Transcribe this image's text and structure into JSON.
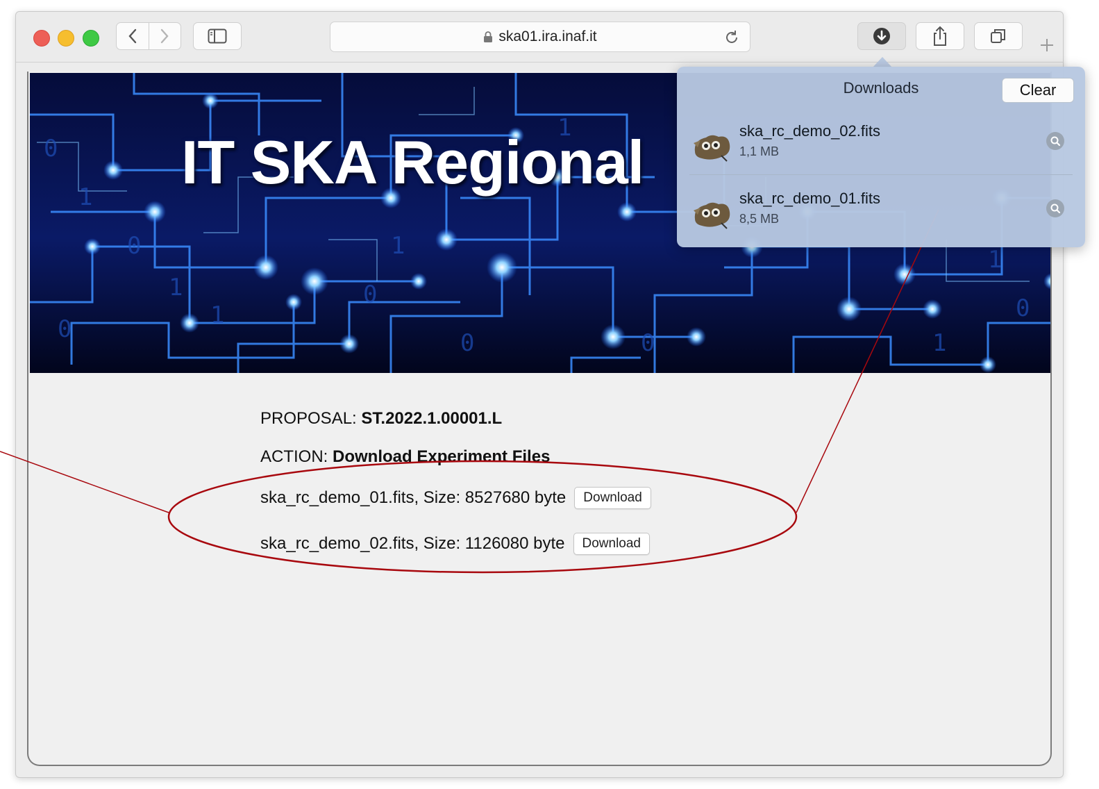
{
  "browser": {
    "url": "ska01.ira.inaf.it"
  },
  "page": {
    "banner_title": "IT SKA Regional",
    "proposal_label": "PROPOSAL:",
    "proposal_value": "ST.2022.1.00001.L",
    "action_label": "ACTION:",
    "action_value": "Download Experiment Files",
    "files": [
      {
        "text": "ska_rc_demo_01.fits, Size: 8527680 byte",
        "button": "Download"
      },
      {
        "text": "ska_rc_demo_02.fits, Size: 1126080 byte",
        "button": "Download"
      }
    ]
  },
  "downloads_popover": {
    "title": "Downloads",
    "clear_label": "Clear",
    "items": [
      {
        "name": "ska_rc_demo_02.fits",
        "size": "1,1 MB"
      },
      {
        "name": "ska_rc_demo_01.fits",
        "size": "8,5 MB"
      }
    ]
  },
  "colors": {
    "annotation": "#a8080e",
    "close": "#ed5f57",
    "minimize": "#f6be2e",
    "zoom": "#3ec944"
  }
}
